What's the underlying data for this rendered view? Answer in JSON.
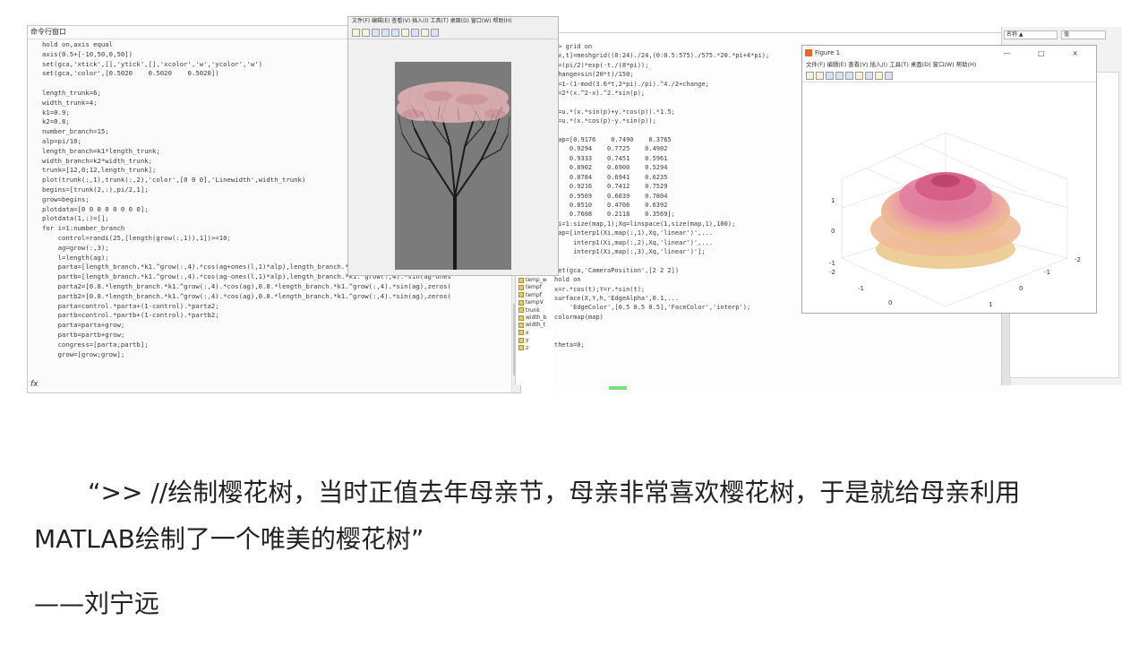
{
  "screenshot": {
    "command_window_title": "命令行窗口",
    "fx_symbol": "fx",
    "code_lines": [
      "hold on,axis equal",
      "axis(0.5+[-10,50,0,50])",
      "set(gca,'xtick',[],'ytick',[],'xcolor','w','ycolor','w')",
      "set(gca,'color',[0.5020    0.5020    0.5020])",
      "",
      "length_trunk=6;",
      "width_trunk=4;",
      "k1=0.9;",
      "k2=0.8;",
      "number_branch=15;",
      "alp=pi/10;",
      "length_branch=k1*length_trunk;",
      "width_branch=k2*width_trunk;",
      "trunk=[12,0;12,length_trunk];",
      "plot(trunk(:,1),trunk(:,2),'color',[0 0 0],'Linewidth',width_trunk)",
      "begins=[trunk(2,:),pi/2,1];",
      "grow=begins;",
      "plotdata=[0 0 0 0 0 0 0 0];",
      "plotdata(1,:)=[];",
      "for i=1:number_branch",
      "    control=randi(25,[length(grow(:,1)),1])>=10;",
      "    ag=grow(:,3);",
      "    l=length(ag);",
      "    parta=[length_branch.*k1.^grow(:,4).*cos(ag+ones(l,1)*alp),length_branch.*k1.^grow(:,4).*sin(ag+ones",
      "    partb=[length_branch.*k1.^grow(:,4).*cos(ag-ones(l,1)*alp),length_branch.*k1.^grow(:,4).*sin(ag-ones",
      "    parta2=[0.8.*length_branch.*k1.^grow(:,4).*cos(ag),0.8.*length_branch.*k1.^grow(:,4).*sin(ag),zeros(",
      "    partb2=[0.8.*length_branch.*k1.^grow(:,4).*cos(ag),0.8.*length_branch.*k1.^grow(:,4).*sin(ag),zeros(",
      "    parta=control.*parta+(1-control).*parta2;",
      "    partb=control.*partb+(1-control).*partb2;",
      "    parta=parta+grow;",
      "    partb=partb+grow;",
      "    congress=[parta;partb];",
      "    grow=[grow;grow];"
    ],
    "workspace_items": [
      "temp_b",
      "temp_w",
      "tempf",
      "tempf",
      "tempV",
      "trunk",
      "width_b",
      "width_t",
      "x",
      "y",
      "z"
    ],
    "code2_lines": [
      ">> grid on",
      "[x,t]=meshgrid((0:24)./24,(0:0.5:575)./575.*20.*pi+4*pi);",
      "p=(pi/2)*exp(-t./(8*pi));",
      "change=sin(20*t)/150;",
      "u=1-(1-mod(3.6*t,2*pi)./pi).^4./2+change;",
      "y=2*(x.^2-x).^2.*sin(p);",
      "",
      "r=u.*(x.*sin(p)+y.*cos(p)).*1.5;",
      "h=u.*(x.*cos(p)-y.*sin(p));",
      "",
      "map=[0.9176    0.7490    0.3765",
      "    0.9294    0.7725    0.4902",
      "    0.9333    0.7451    0.5961",
      "    0.8902    0.6900    0.5294",
      "    0.8784    0.6941    0.6235",
      "    0.9216    0.7412    0.7529",
      "    0.9569    0.6039    0.7804",
      "    0.8510    0.4706    0.6392",
      "    0.7608    0.2118    0.3569];",
      "Xi=1:size(map,1);Xq=linspace(1,size(map,1),100);",
      "map=[interp1(Xi,map(:,1),Xq,'linear')',...",
      "     interp1(Xi,map(:,2),Xq,'linear')',...",
      "     interp1(Xi,map(:,3),Xq,'linear')'];",
      "",
      "set(gca,'CameraPosition',[2 2 2])",
      "hold on",
      "x=r.*cos(t);Y=r.*sin(t);",
      "surface(X,Y,h,'EdgeAlpha',0.1,...",
      "    'EdgeColor',[0.5 0.5 0.5],'FaceColor','interp');",
      "colormap(map)",
      "",
      "",
      "theta=0;"
    ],
    "figure_title": "Figure 1",
    "figure_controls": "— □ ×",
    "figure_menu": "文件(F)  编辑(E)  查看(V)  插入(I)  工具(T)  桌面(D)  窗口(W)  帮助(H)",
    "fig1_menu": "文件(F)  编辑(E)  查看(V)  插入(I)  工具(T)  桌面(D)  窗口(W)  帮助(H)",
    "right_panel_labels": [
      "名称 ▲",
      "值"
    ],
    "axis_ticks_z": [
      "1",
      "0",
      "-1"
    ],
    "axis_ticks_x": [
      "-2",
      "-1",
      "0",
      "1",
      "2"
    ],
    "axis_ticks_y": [
      "2",
      "1",
      "0",
      "-1",
      "-2"
    ]
  },
  "caption": {
    "quote": "“>> //绘制樱花树，当时正值去年母亲节，母亲非常喜欢樱花树，于是就给母亲利用MATLAB绘制了一个唯美的樱花树”",
    "author": "——刘宁远"
  }
}
